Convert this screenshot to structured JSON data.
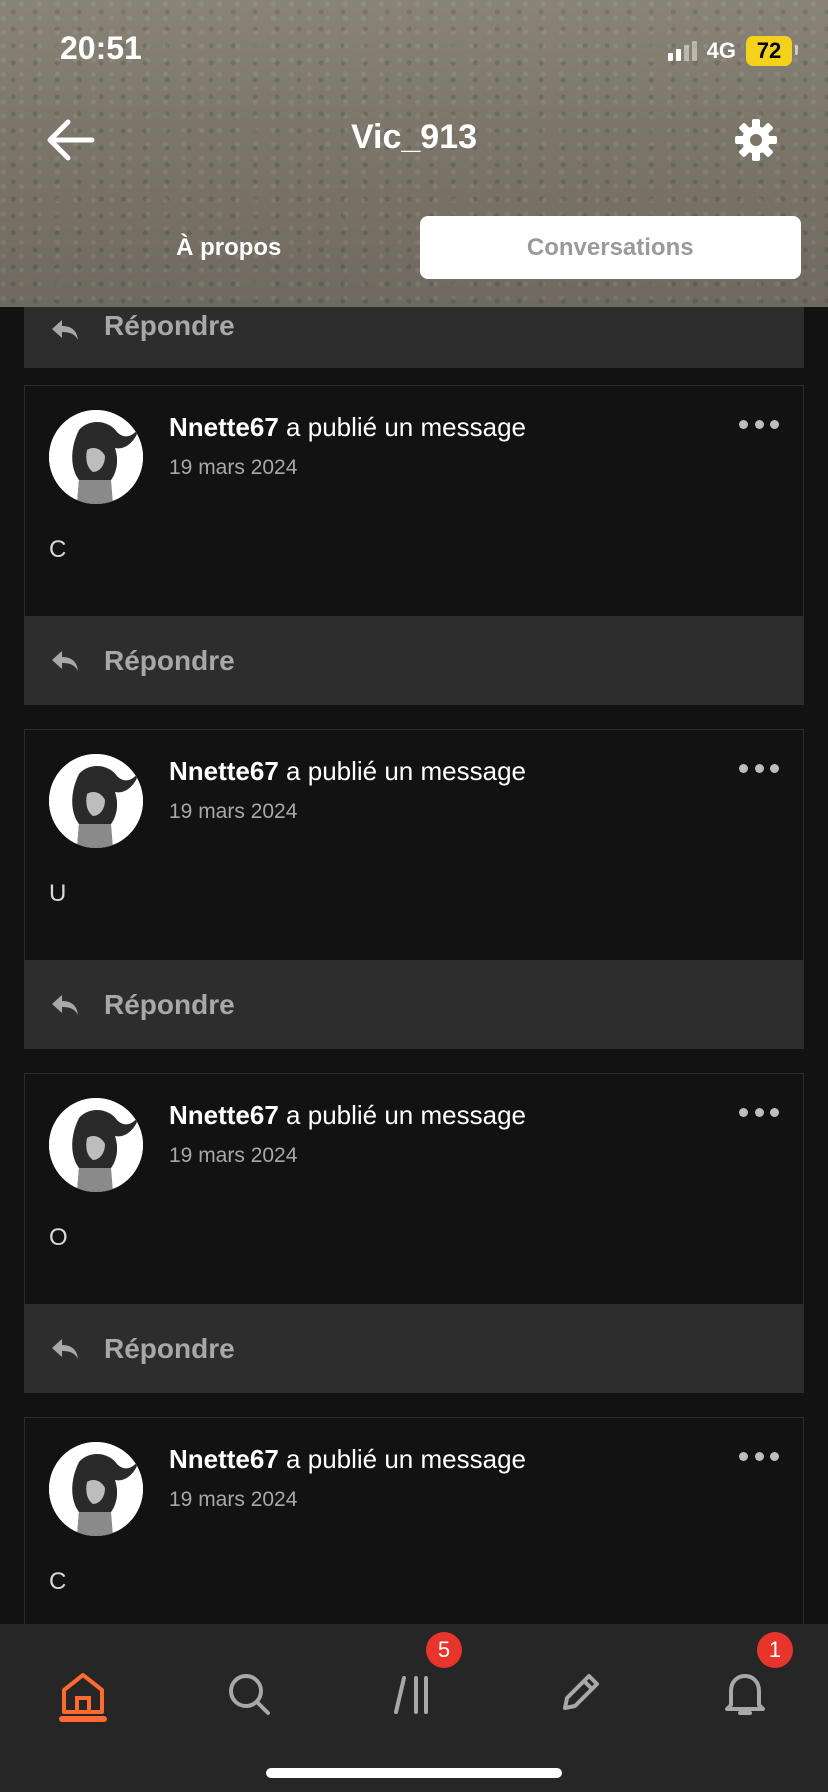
{
  "status_bar": {
    "time": "20:51",
    "network": "4G",
    "battery": "72"
  },
  "header": {
    "title": "Vic_913",
    "back_icon": "arrow-left-icon",
    "settings_icon": "gear-icon"
  },
  "tabs": [
    {
      "label": "À propos",
      "active": false
    },
    {
      "label": "Conversations",
      "active": true
    }
  ],
  "feed": {
    "reply_label": "Répondre",
    "posts": [
      {
        "author": "Nnette67",
        "action": " a publié un message",
        "date": "19 mars 2024",
        "body": "C"
      },
      {
        "author": "Nnette67",
        "action": " a publié un message",
        "date": "19 mars 2024",
        "body": "U"
      },
      {
        "author": "Nnette67",
        "action": " a publié un message",
        "date": "19 mars 2024",
        "body": "O"
      },
      {
        "author": "Nnette67",
        "action": " a publié un message",
        "date": "19 mars 2024",
        "body": "C"
      }
    ]
  },
  "bottom_nav": {
    "items": [
      {
        "icon": "home-icon",
        "active": true
      },
      {
        "icon": "search-icon",
        "active": false
      },
      {
        "icon": "library-icon",
        "active": false,
        "badge": "5"
      },
      {
        "icon": "pencil-icon",
        "active": false
      },
      {
        "icon": "bell-icon",
        "active": false,
        "badge": "1"
      }
    ]
  },
  "colors": {
    "accent": "#ff6a30",
    "badge": "#e8352b",
    "background": "#121212",
    "reply_bar": "#2d2d2d"
  }
}
